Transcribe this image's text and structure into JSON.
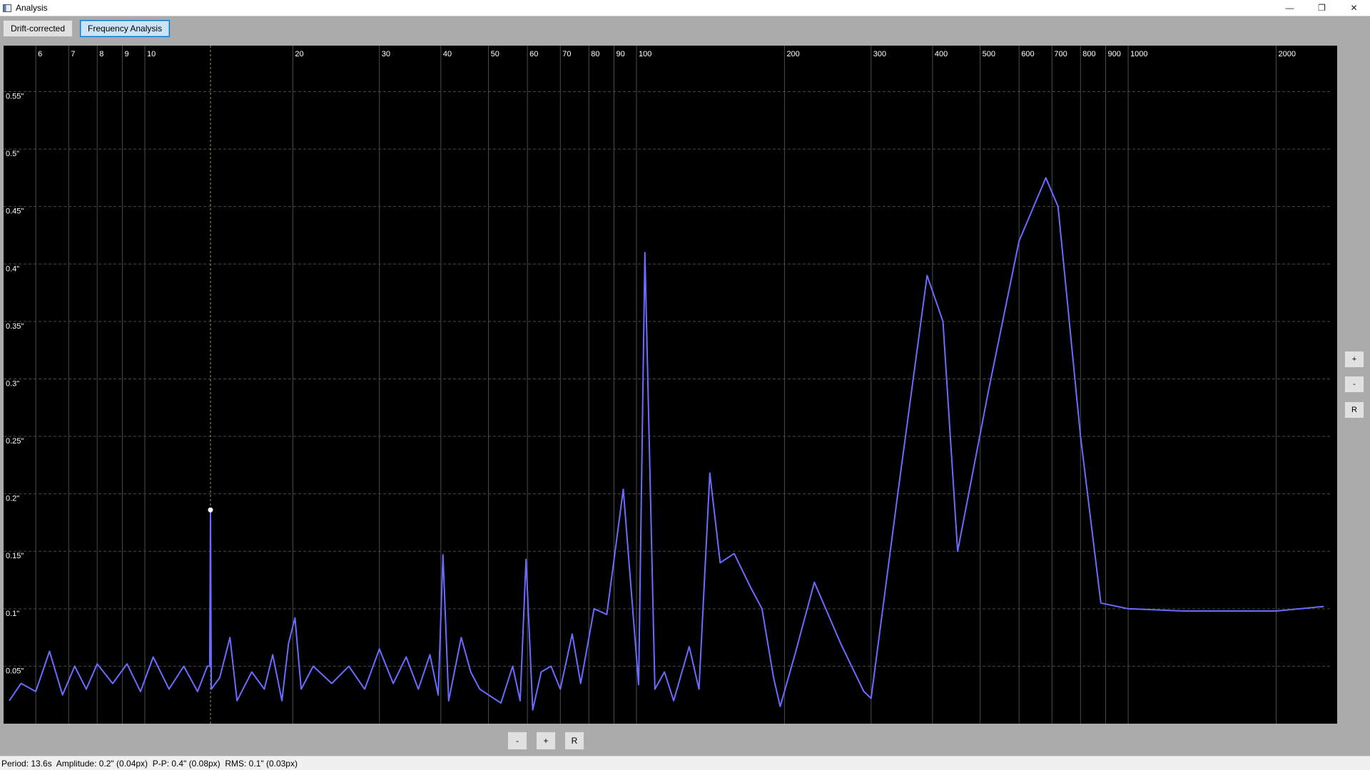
{
  "window": {
    "title": "Analysis",
    "controls": {
      "minimize": "—",
      "restore": "❐",
      "close": "✕"
    }
  },
  "tabs": [
    {
      "label": "Drift-corrected",
      "active": false
    },
    {
      "label": "Frequency Analysis",
      "active": true
    }
  ],
  "zoom_controls": {
    "side": {
      "zoom_in": "+",
      "zoom_out": "-",
      "reset": "R"
    },
    "bottom": {
      "zoom_out": "-",
      "zoom_in": "+",
      "reset": "R"
    }
  },
  "status": {
    "text": "Period: 13.6s  Amplitude: 0.2\" (0.04px)  P-P: 0.4\" (0.08px)  RMS: 0.1\" (0.03px)"
  },
  "colors": {
    "background": "#000000",
    "curve": "#6a6cff",
    "grid": "#4a4a4a",
    "cursor": "#a0a050"
  },
  "chart_data": {
    "type": "line",
    "x_scale": "log",
    "xlim": [
      5.3,
      2600
    ],
    "ylim": [
      0.0,
      0.59
    ],
    "grid": true,
    "x_ticks": [
      6,
      7,
      8,
      9,
      10,
      20,
      30,
      40,
      50,
      60,
      70,
      80,
      90,
      100,
      200,
      300,
      400,
      500,
      600,
      700,
      800,
      900,
      1000,
      2000
    ],
    "y_ticks": [
      {
        "value": 0.05,
        "label": "0.05\""
      },
      {
        "value": 0.1,
        "label": "0.1\""
      },
      {
        "value": 0.15,
        "label": "0.15\""
      },
      {
        "value": 0.2,
        "label": "0.2\""
      },
      {
        "value": 0.25,
        "label": "0.25\""
      },
      {
        "value": 0.3,
        "label": "0.3\""
      },
      {
        "value": 0.35,
        "label": "0.35\""
      },
      {
        "value": 0.4,
        "label": "0.4\""
      },
      {
        "value": 0.45,
        "label": "0.45\""
      },
      {
        "value": 0.5,
        "label": "0.5\""
      },
      {
        "value": 0.55,
        "label": "0.55\""
      }
    ],
    "cursor": {
      "x": 13.6,
      "y": 0.186
    },
    "series": [
      {
        "values": [
          [
            5.3,
            0.02
          ],
          [
            5.6,
            0.035
          ],
          [
            6.0,
            0.028
          ],
          [
            6.4,
            0.063
          ],
          [
            6.8,
            0.025
          ],
          [
            7.2,
            0.05
          ],
          [
            7.6,
            0.03
          ],
          [
            8.0,
            0.052
          ],
          [
            8.6,
            0.035
          ],
          [
            9.2,
            0.052
          ],
          [
            9.8,
            0.028
          ],
          [
            10.4,
            0.058
          ],
          [
            11.2,
            0.03
          ],
          [
            12.0,
            0.05
          ],
          [
            12.8,
            0.028
          ],
          [
            13.4,
            0.05
          ],
          [
            13.55,
            0.05
          ],
          [
            13.6,
            0.186
          ],
          [
            13.65,
            0.03
          ],
          [
            14.2,
            0.04
          ],
          [
            14.9,
            0.075
          ],
          [
            15.4,
            0.02
          ],
          [
            16.5,
            0.045
          ],
          [
            17.5,
            0.03
          ],
          [
            18.2,
            0.06
          ],
          [
            19.0,
            0.02
          ],
          [
            19.6,
            0.07
          ],
          [
            20.2,
            0.092
          ],
          [
            20.8,
            0.03
          ],
          [
            22,
            0.05
          ],
          [
            24,
            0.035
          ],
          [
            26,
            0.05
          ],
          [
            28,
            0.03
          ],
          [
            30,
            0.065
          ],
          [
            32,
            0.035
          ],
          [
            34,
            0.058
          ],
          [
            36,
            0.03
          ],
          [
            38,
            0.06
          ],
          [
            39.5,
            0.025
          ],
          [
            40.4,
            0.147
          ],
          [
            41.5,
            0.02
          ],
          [
            44,
            0.075
          ],
          [
            46,
            0.045
          ],
          [
            48,
            0.03
          ],
          [
            50,
            0.025
          ],
          [
            53,
            0.018
          ],
          [
            56,
            0.05
          ],
          [
            58,
            0.02
          ],
          [
            59.6,
            0.143
          ],
          [
            61.5,
            0.012
          ],
          [
            64,
            0.045
          ],
          [
            67,
            0.05
          ],
          [
            70,
            0.03
          ],
          [
            74,
            0.078
          ],
          [
            77,
            0.035
          ],
          [
            82,
            0.1
          ],
          [
            87,
            0.095
          ],
          [
            94,
            0.204
          ],
          [
            101,
            0.034
          ],
          [
            104,
            0.41
          ],
          [
            109,
            0.03
          ],
          [
            114,
            0.045
          ],
          [
            119,
            0.02
          ],
          [
            128,
            0.067
          ],
          [
            134,
            0.03
          ],
          [
            141,
            0.218
          ],
          [
            148,
            0.14
          ],
          [
            158,
            0.148
          ],
          [
            170,
            0.12
          ],
          [
            180,
            0.1
          ],
          [
            190,
            0.04
          ],
          [
            196,
            0.015
          ],
          [
            210,
            0.06
          ],
          [
            230,
            0.123
          ],
          [
            260,
            0.07
          ],
          [
            290,
            0.028
          ],
          [
            300,
            0.022
          ],
          [
            340,
            0.2
          ],
          [
            390,
            0.39
          ],
          [
            420,
            0.35
          ],
          [
            450,
            0.15
          ],
          [
            520,
            0.29
          ],
          [
            600,
            0.42
          ],
          [
            680,
            0.475
          ],
          [
            720,
            0.45
          ],
          [
            800,
            0.25
          ],
          [
            880,
            0.105
          ],
          [
            1000,
            0.1
          ],
          [
            1300,
            0.098
          ],
          [
            2000,
            0.098
          ],
          [
            2500,
            0.102
          ]
        ]
      }
    ]
  }
}
